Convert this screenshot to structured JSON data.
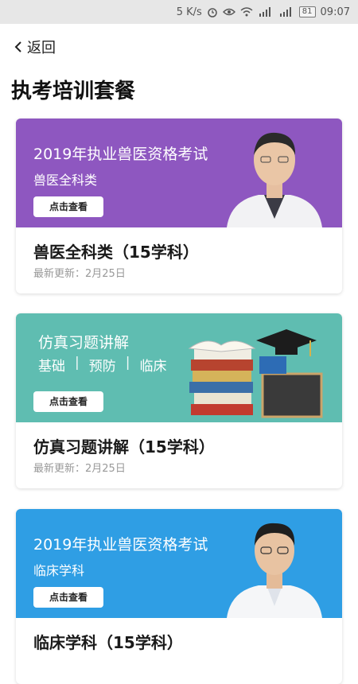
{
  "status_bar": {
    "speed": "5 K/s",
    "battery": "81",
    "time": "09:07",
    "icons": [
      "alarm-icon",
      "eye-icon",
      "wifi-icon",
      "signal-4g-icon",
      "signal-2g-icon",
      "battery-icon"
    ]
  },
  "header": {
    "back_label": "返回",
    "title": "执考培训套餐"
  },
  "cards": [
    {
      "banner_color": "#8e57c0",
      "banner_line1": "2019年执业兽医资格考试",
      "banner_line2": "兽医全科类",
      "button": "点击查看",
      "title": "兽医全科类（15学科）",
      "meta": "最新更新：2月25日",
      "illustration": "doctor-portrait"
    },
    {
      "banner_color": "#5fbdb1",
      "banner_line1": "仿真习题讲解",
      "tags": [
        "基础",
        "预防",
        "临床"
      ],
      "tag_separator": "|",
      "button": "点击查看",
      "title": "仿真习题讲解（15学科）",
      "meta": "最新更新：2月25日",
      "illustration": "books-and-cap"
    },
    {
      "banner_color": "#2f9ee4",
      "banner_line1": "2019年执业兽医资格考试",
      "banner_line2": "临床学科",
      "button": "点击查看",
      "title": "临床学科（15学科）",
      "illustration": "doctor-portrait"
    }
  ]
}
